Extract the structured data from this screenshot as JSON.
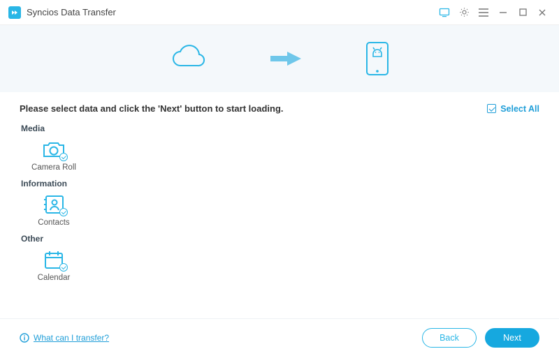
{
  "app": {
    "title": "Syncios Data Transfer"
  },
  "hero": {
    "source": "cloud-icon",
    "arrow": "arrow-right-icon",
    "target": "android-phone-icon"
  },
  "instruction": "Please select data and click the 'Next' button to start loading.",
  "select_all": {
    "label": "Select All",
    "checked": true
  },
  "sections": {
    "media": {
      "label": "Media",
      "items": [
        {
          "label": "Camera Roll"
        }
      ]
    },
    "info": {
      "label": "Information",
      "items": [
        {
          "label": "Contacts"
        }
      ]
    },
    "other": {
      "label": "Other",
      "items": [
        {
          "label": "Calendar"
        }
      ]
    }
  },
  "footer": {
    "help": "What can I transfer?",
    "back": "Back",
    "next": "Next"
  }
}
